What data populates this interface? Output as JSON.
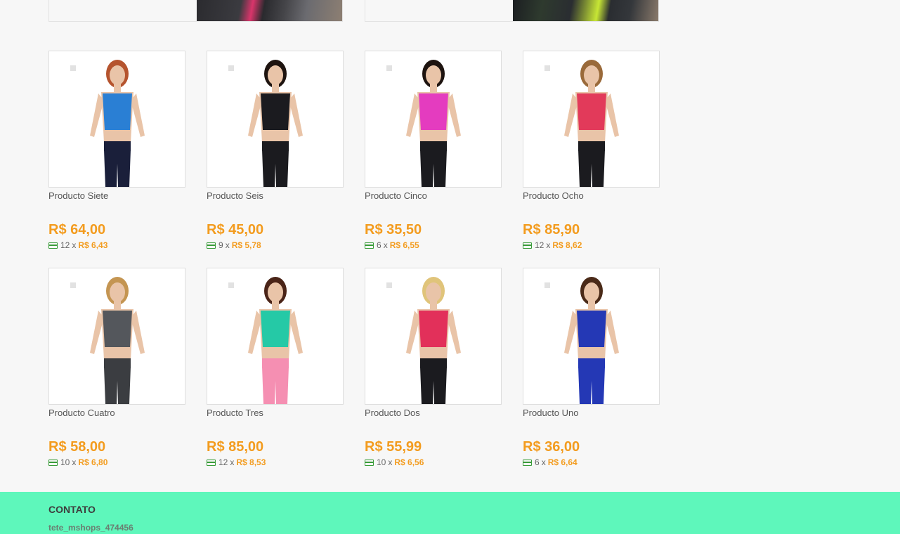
{
  "banners": [
    {
      "name": "banner-left"
    },
    {
      "name": "banner-right"
    }
  ],
  "products": [
    {
      "name": "Producto Siete",
      "price": "R$ 64,00",
      "installments": "12",
      "installment_value": "R$ 6,43",
      "top_color": "#2a7fd4",
      "bottom_color": "#1a1f3a",
      "hair_color": "#b5542e"
    },
    {
      "name": "Producto Seis",
      "price": "R$ 45,00",
      "installments": "9",
      "installment_value": "R$ 5,78",
      "top_color": "#1b1b1f",
      "bottom_color": "#1b1b1f",
      "hair_color": "#1e1410"
    },
    {
      "name": "Producto Cinco",
      "price": "R$ 35,50",
      "installments": "6",
      "installment_value": "R$ 6,55",
      "top_color": "#e43cbf",
      "bottom_color": "#1b1b1f",
      "hair_color": "#1e1410"
    },
    {
      "name": "Producto Ocho",
      "price": "R$ 85,90",
      "installments": "12",
      "installment_value": "R$ 8,62",
      "top_color": "#e23a5a",
      "bottom_color": "#1b1b1f",
      "hair_color": "#9a6a3a"
    },
    {
      "name": "Producto Cuatro",
      "price": "R$ 58,00",
      "installments": "10",
      "installment_value": "R$ 6,80",
      "top_color": "#54575c",
      "bottom_color": "#3b3d41",
      "hair_color": "#c49552"
    },
    {
      "name": "Producto Tres",
      "price": "R$ 85,00",
      "installments": "12",
      "installment_value": "R$ 8,53",
      "top_color": "#25c9a6",
      "bottom_color": "#f58fb2",
      "hair_color": "#4a2418"
    },
    {
      "name": "Producto Dos",
      "price": "R$ 55,99",
      "installments": "10",
      "installment_value": "R$ 6,56",
      "top_color": "#e2305a",
      "bottom_color": "#1b1b1f",
      "hair_color": "#e0c47a"
    },
    {
      "name": "Producto Uno",
      "price": "R$ 36,00",
      "installments": "6",
      "installment_value": "R$ 6,64",
      "top_color": "#2438b5",
      "bottom_color": "#2438b5",
      "hair_color": "#4a2a18"
    }
  ],
  "installment_separator": "x",
  "footer": {
    "title": "CONTATO",
    "user": "tete_mshops_474456",
    "background": "#5ef7bb"
  },
  "colors": {
    "price": "#f39c1f",
    "card_icon": "#3a9c3a"
  }
}
